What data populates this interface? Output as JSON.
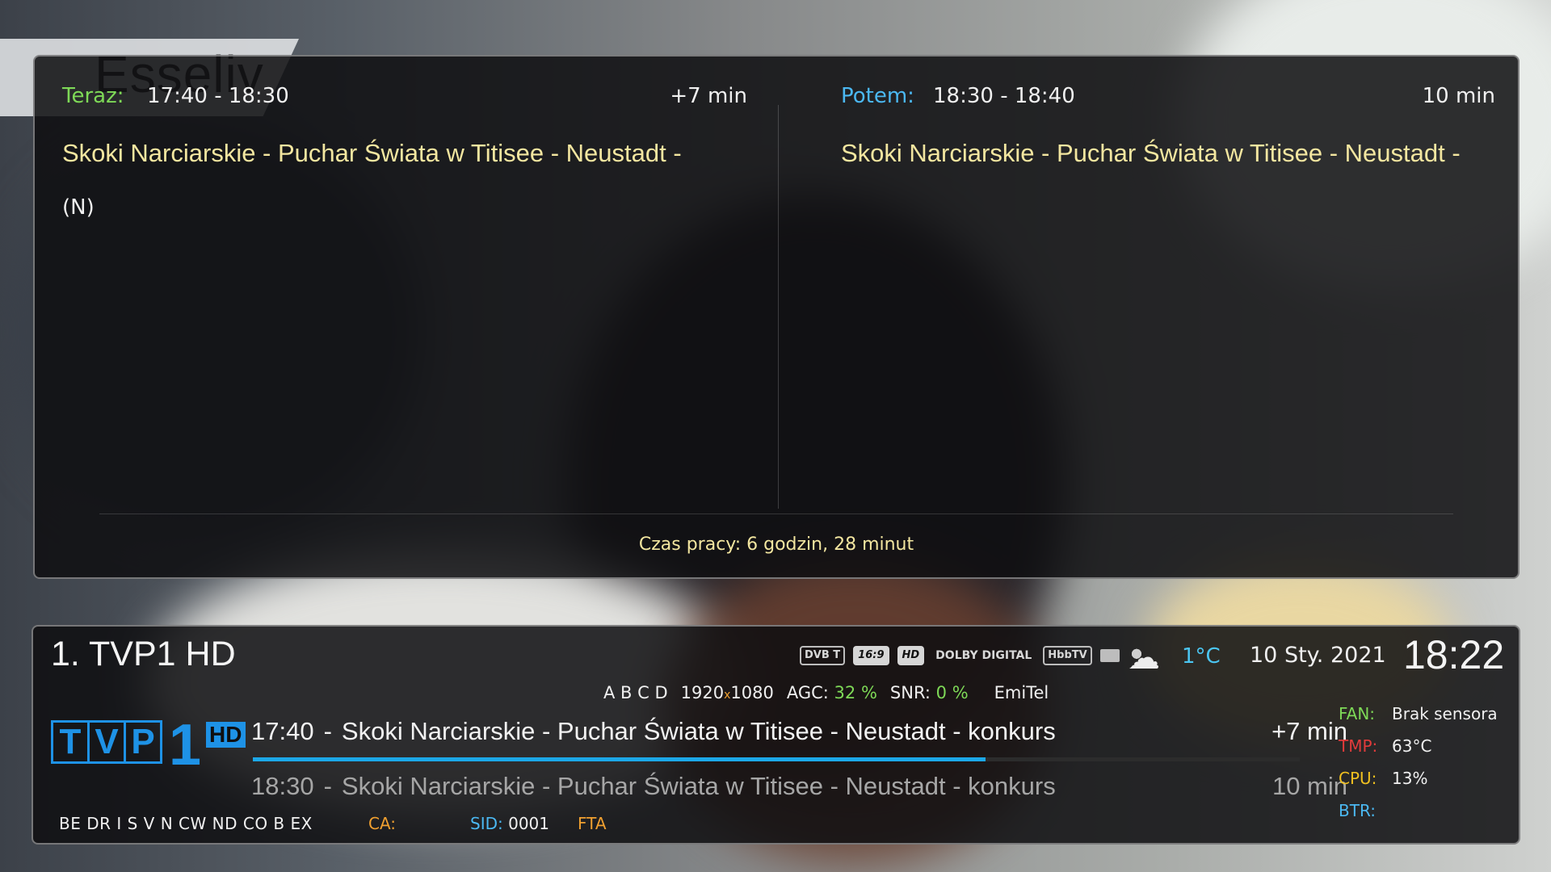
{
  "background": {
    "watermark": "Esseliv"
  },
  "epg": {
    "now": {
      "label": "Teraz:",
      "time": "17:40 - 18:30",
      "delta": "+7 min",
      "title": "Skoki Narciarskie - Puchar Świata w Titisee - Neustadt -",
      "flag": "(N)"
    },
    "next": {
      "label": "Potem:",
      "time": "18:30 - 18:40",
      "duration": "10 min",
      "title": "Skoki Narciarskie - Puchar Świata w Titisee - Neustadt -"
    },
    "uptime": "Czas pracy: 6 godzin, 28 minut"
  },
  "infobar": {
    "channel": "1. TVP1 HD",
    "icons": [
      "DVB T",
      "16:9",
      "HD",
      "DOLBY DIGITAL",
      "HbbTV"
    ],
    "weather": {
      "icon": "cloudy-icon",
      "temperature": "1°C"
    },
    "date": "10 Sty. 2021",
    "clock": "18:22",
    "tuner": {
      "slots": "A B C D",
      "res_w": "1920",
      "res_x": "x",
      "res_h": "1080",
      "agc_label": "AGC:",
      "agc_value": "32 %",
      "snr_label": "SNR:",
      "snr_value": "0 %",
      "provider": "EmiTel"
    },
    "logo": {
      "letters": [
        "T",
        "V",
        "P"
      ],
      "number": "1",
      "hd": "HD"
    },
    "events": {
      "now": {
        "time": "17:40",
        "sep": "-",
        "title": "Skoki Narciarskie - Puchar Świata w Titisee - Neustadt - konkurs",
        "remaining": "+7 min",
        "progress_percent": 70
      },
      "next": {
        "time": "18:30",
        "sep": "-",
        "title": "Skoki Narciarskie - Puchar Świata w Titisee - Neustadt - konkurs",
        "duration": "10 min"
      }
    },
    "ca_systems": "BE DR I S V N CW ND CO B EX",
    "ca_label": "CA:",
    "sid_label": "SID:",
    "sid_value": "0001",
    "fta": "FTA",
    "system": {
      "fan": {
        "label": "FAN:",
        "value": "Brak sensora"
      },
      "tmp": {
        "label": "TMP:",
        "value": "63°C"
      },
      "cpu": {
        "label": "CPU:",
        "value": "13%"
      },
      "btr": {
        "label": "BTR:",
        "value": ""
      }
    },
    "colors": {
      "accent_blue": "#1ca8e8",
      "now_green": "#7ed957",
      "title_yellow": "#f3e6a0",
      "ca_orange": "#f0a030"
    }
  }
}
